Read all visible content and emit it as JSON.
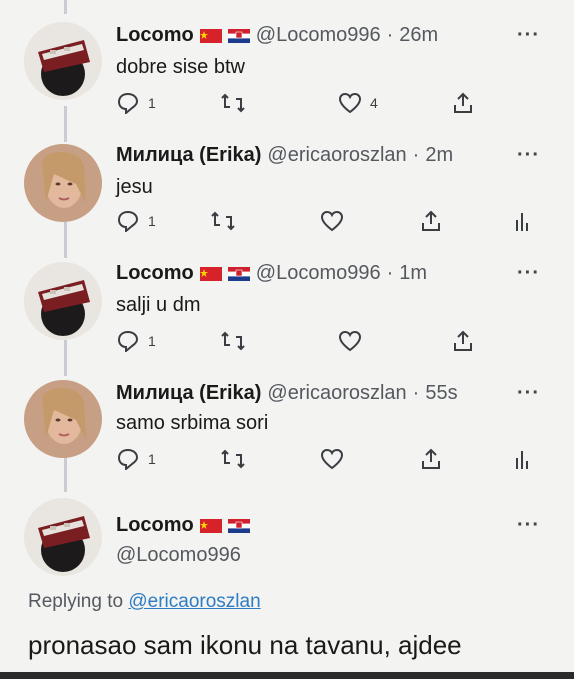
{
  "tweets": [
    {
      "name": "Locomo",
      "handle": "@Locomo996",
      "dot": "·",
      "time": "26m",
      "text": "dobre sise btw",
      "reply_count": "1",
      "like_count": "4",
      "avatar": "locomo-avatar",
      "icons": [
        "reply-icon",
        "retweet-icon",
        "like-icon",
        "share-icon"
      ]
    },
    {
      "name": "Милица (Erika)",
      "handle": "@ericaoroszlan",
      "dot": "·",
      "time": "2m",
      "text": "jesu",
      "reply_count": "1",
      "avatar": "erika-avatar",
      "icons": [
        "reply-icon",
        "retweet-icon",
        "like-icon",
        "share-icon",
        "analytics-icon"
      ]
    },
    {
      "name": "Locomo",
      "handle": "@Locomo996",
      "dot": "·",
      "time": "1m",
      "text": "salji u dm",
      "reply_count": "1",
      "avatar": "locomo-avatar",
      "icons": [
        "reply-icon",
        "retweet-icon",
        "like-icon",
        "share-icon"
      ]
    },
    {
      "name": "Милица (Erika)",
      "handle": "@ericaoroszlan",
      "dot": "·",
      "time": "55s",
      "text": "samo srbima sori",
      "reply_count": "1",
      "avatar": "erika-avatar",
      "icons": [
        "reply-icon",
        "retweet-icon",
        "like-icon",
        "share-icon",
        "analytics-icon"
      ]
    }
  ],
  "main_tweet": {
    "name": "Locomo",
    "handle": "@Locomo996",
    "replying_prefix": "Replying to",
    "replying_mention": "@ericaoroszlan",
    "text": "pronasao sam ikonu na tavanu, ajdee"
  },
  "more_label": "···",
  "colors": {
    "background": "#f3f3f1",
    "text": "#1a1a1a",
    "secondary": "#55595f",
    "mention": "#2d7cc4",
    "thread_line": "#c9cdd2"
  }
}
